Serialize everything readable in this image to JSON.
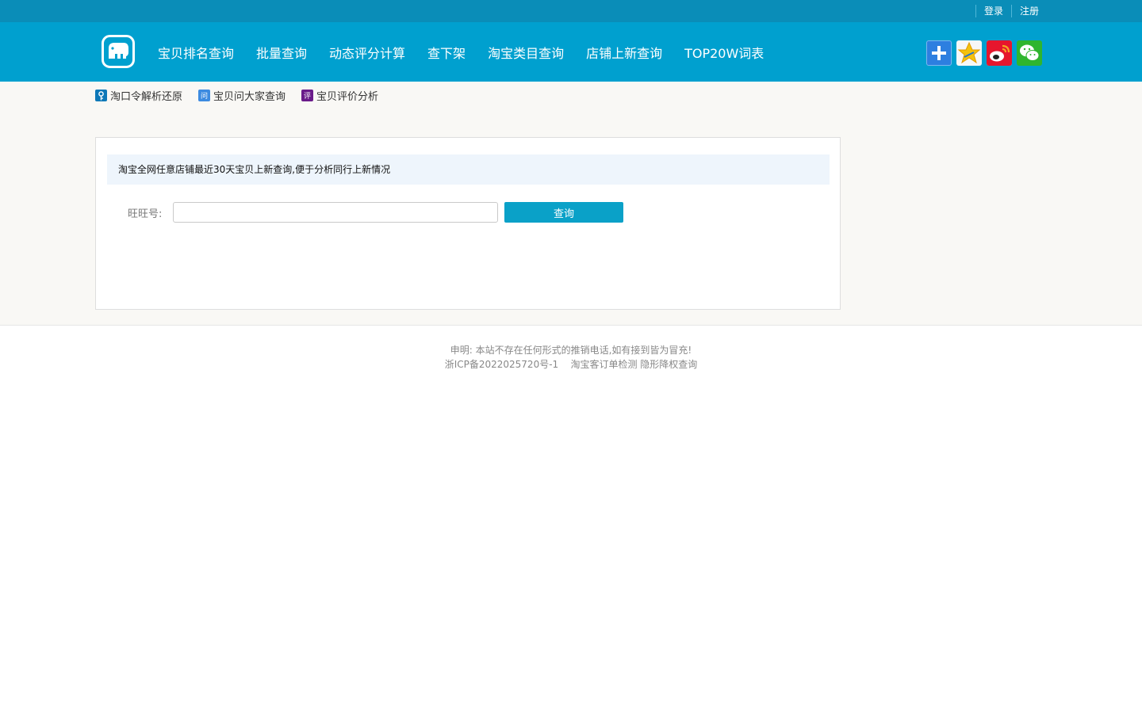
{
  "topbar": {
    "login": "登录",
    "register": "注册"
  },
  "header": {
    "nav": [
      {
        "label": "宝贝排名查询"
      },
      {
        "label": "批量查询"
      },
      {
        "label": "动态评分计算"
      },
      {
        "label": "查下架"
      },
      {
        "label": "淘宝类目查询"
      },
      {
        "label": "店铺上新查询"
      },
      {
        "label": "TOP20W词表"
      }
    ],
    "social_icons": [
      "plus-icon",
      "qzone-star-icon",
      "weibo-icon",
      "wechat-icon"
    ]
  },
  "subnav": {
    "items": [
      {
        "label": "淘口令解析还原",
        "badge": "key-icon"
      },
      {
        "label": "宝贝问大家查询",
        "badge_text": "问"
      },
      {
        "label": "宝贝评价分析",
        "badge_text": "评"
      }
    ]
  },
  "panel": {
    "notice": "淘宝全网任意店铺最近30天宝贝上新查询,便于分析同行上新情况",
    "field_label": "旺旺号:",
    "input_value": "",
    "input_placeholder": "",
    "submit_label": "查询"
  },
  "footer": {
    "line1": "申明: 本站不存在任何形式的推销电话,如有接到皆为冒充!",
    "icp": "浙ICP备2022025720号-1",
    "link1": "淘宝客订单检测",
    "link2": "隐形降权查询"
  },
  "colors": {
    "topbar": "#0a8db8",
    "header": "#00a0cf",
    "button": "#0aa1c8",
    "notice_bg": "#eef5fc"
  }
}
